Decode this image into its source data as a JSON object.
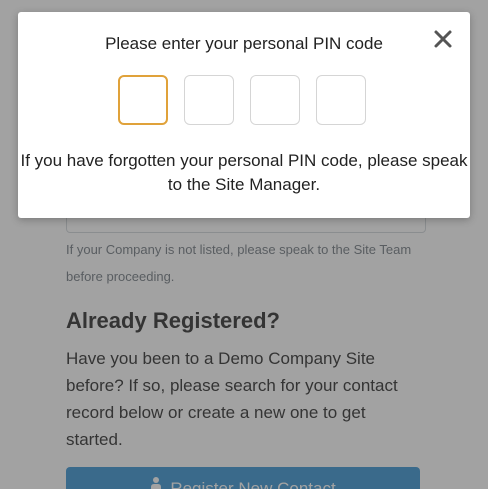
{
  "page": {
    "help_note": "If your Company is not listed, please speak to the Site Team before proceeding.",
    "section_title": "Already Registered?",
    "section_body": "Have you been to a Demo Company Site before? If so, please search for your contact record below or create a new one to get started.",
    "register_button_label": "Register New Contact"
  },
  "modal": {
    "title": "Please enter your personal PIN code",
    "close_glyph": "✕",
    "pin_digits": [
      "",
      "",
      "",
      ""
    ],
    "hint": "If you have forgotten your personal PIN code, please speak to the Site Manager."
  },
  "colors": {
    "pin_focus_border": "#e0a23a",
    "backdrop": "#464646",
    "primary_button": "#2f8fd0"
  },
  "icons": {
    "close": "close-icon",
    "register": "person-icon"
  }
}
